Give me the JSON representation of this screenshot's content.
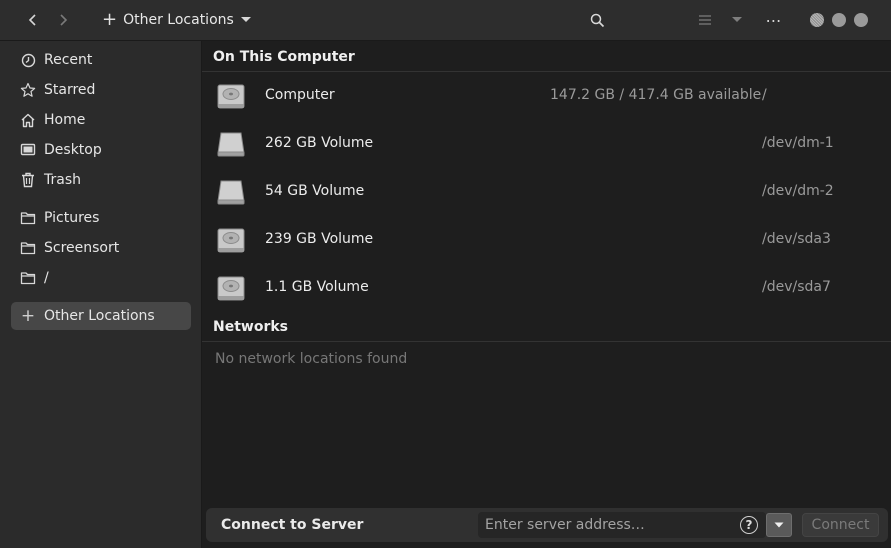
{
  "header": {
    "location_label": "Other Locations",
    "menu_glyph": "⋯"
  },
  "sidebar": {
    "items": [
      {
        "label": "Recent",
        "icon": "clock-icon"
      },
      {
        "label": "Starred",
        "icon": "star-icon"
      },
      {
        "label": "Home",
        "icon": "home-icon"
      },
      {
        "label": "Desktop",
        "icon": "desktop-icon"
      },
      {
        "label": "Trash",
        "icon": "trash-icon"
      },
      {
        "label": "Pictures",
        "icon": "folder-icon"
      },
      {
        "label": "Screensort",
        "icon": "folder-icon"
      },
      {
        "label": "/",
        "icon": "folder-icon"
      },
      {
        "label": "Other Locations",
        "icon": "plus-icon",
        "active": true
      }
    ]
  },
  "main": {
    "on_this_computer_title": "On This Computer",
    "drives": [
      {
        "name": "Computer",
        "available": "147.2 GB / 417.4 GB available",
        "path": "/",
        "icon": "hard-disk-icon"
      },
      {
        "name": "262 GB Volume",
        "available": "",
        "path": "/dev/dm-1",
        "icon": "drive-icon"
      },
      {
        "name": "54 GB Volume",
        "available": "",
        "path": "/dev/dm-2",
        "icon": "drive-icon"
      },
      {
        "name": "239 GB Volume",
        "available": "",
        "path": "/dev/sda3",
        "icon": "hard-disk-icon"
      },
      {
        "name": "1.1 GB Volume",
        "available": "",
        "path": "/dev/sda7",
        "icon": "hard-disk-icon"
      }
    ],
    "networks_title": "Networks",
    "networks_empty": "No network locations found"
  },
  "bottom": {
    "title": "Connect to Server",
    "placeholder": "Enter server address…",
    "help_glyph": "?",
    "connect_label": "Connect"
  }
}
